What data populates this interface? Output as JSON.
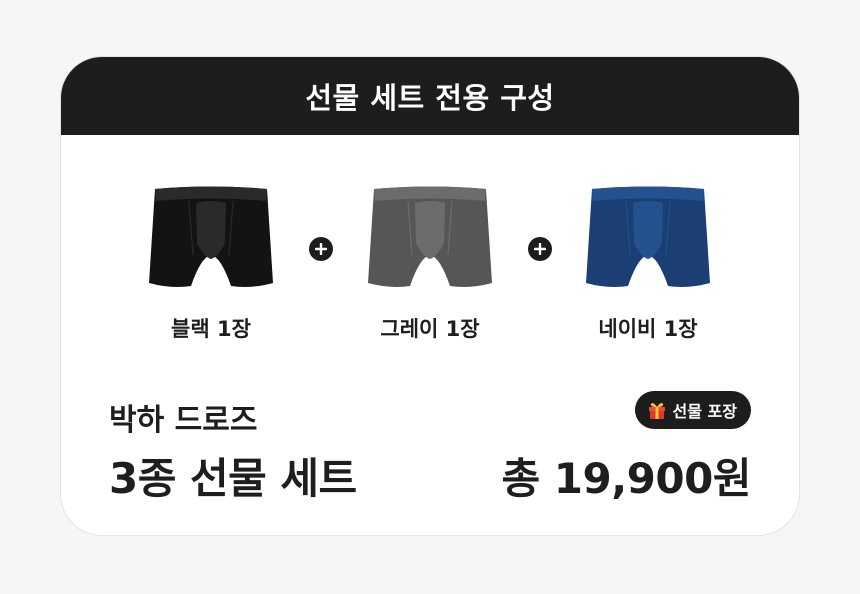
{
  "header": {
    "title": "선물 세트 전용 구성"
  },
  "products": [
    {
      "label": "블랙 1장",
      "color": "#131313",
      "shade": "#2a2a2a"
    },
    {
      "label": "그레이 1장",
      "color": "#565656",
      "shade": "#6c6c6c"
    },
    {
      "label": "네이비 1장",
      "color": "#1b3f73",
      "shade": "#24518f"
    }
  ],
  "plus_icon": "plus-icon",
  "brand": "박하 드로즈",
  "set_name": "3종 선물 세트",
  "badge": {
    "icon": "gift-icon",
    "label": "선물 포장"
  },
  "price": "총 19,900원"
}
